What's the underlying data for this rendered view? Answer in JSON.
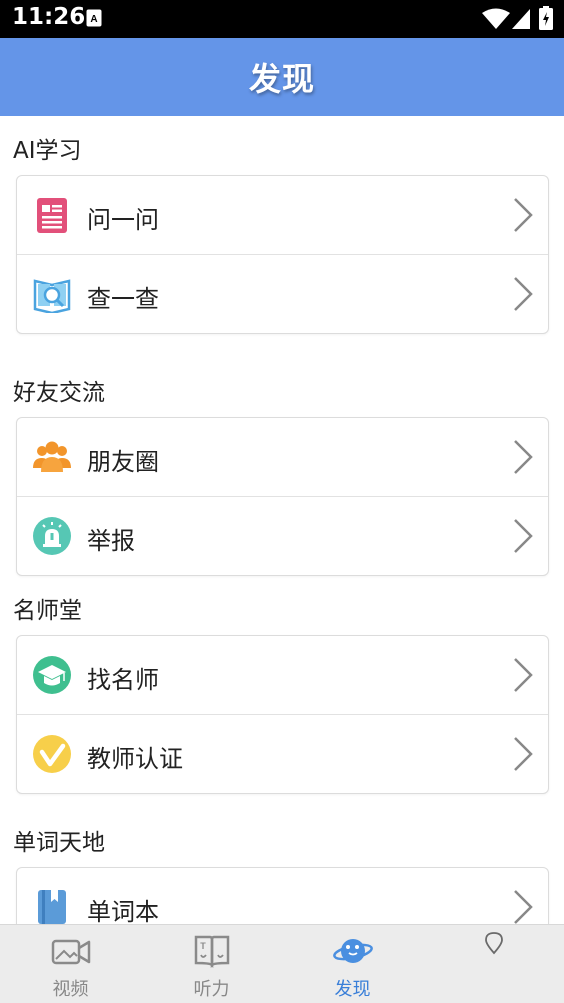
{
  "status_bar": {
    "time": "11:26"
  },
  "header": {
    "title": "发现"
  },
  "sections": [
    {
      "title": "AI学习",
      "items": [
        {
          "label": "问一问",
          "icon": "document-icon"
        },
        {
          "label": "查一查",
          "icon": "book-search-icon"
        }
      ]
    },
    {
      "title": "好友交流",
      "items": [
        {
          "label": "朋友圈",
          "icon": "friends-group-icon"
        },
        {
          "label": "举报",
          "icon": "alarm-icon"
        }
      ]
    },
    {
      "title": "名师堂",
      "items": [
        {
          "label": "找名师",
          "icon": "graduation-cap-icon"
        },
        {
          "label": "教师认证",
          "icon": "checkmark-badge-icon"
        }
      ]
    },
    {
      "title": "单词天地",
      "items": [
        {
          "label": "单词本",
          "icon": "wordbook-icon"
        }
      ]
    }
  ],
  "tabs": [
    {
      "label": "视频",
      "icon": "video-camera-icon",
      "active": false
    },
    {
      "label": "听力",
      "icon": "listening-book-icon",
      "active": false
    },
    {
      "label": "发现",
      "icon": "planet-icon",
      "active": true
    },
    {
      "label": "",
      "icon": "location-pin-icon",
      "active": false
    }
  ],
  "colors": {
    "header_bg": "#6495e8",
    "active_tab": "#3a7fd8",
    "inactive_tab": "#888888"
  }
}
